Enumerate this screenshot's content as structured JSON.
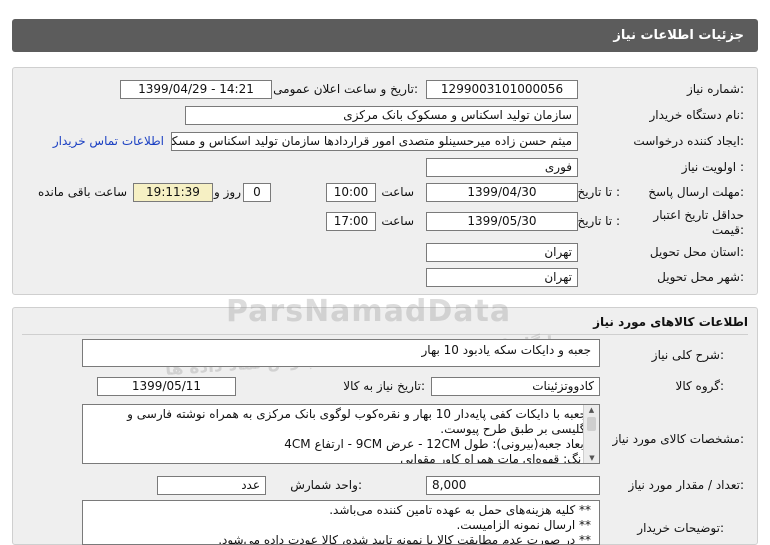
{
  "header": {
    "title": "جزئیات اطلاعات نیاز"
  },
  "request": {
    "number_label": "شماره نیاز:",
    "number": "1299003101000056",
    "announce_label": "تاریخ و ساعت اعلان عمومی:",
    "announce_value": "1399/04/29 - 14:21",
    "buyer_org_label": "نام دستگاه خریدار:",
    "buyer_org": "سازمان تولید اسکناس و مسکوک بانک مرکزی",
    "creator_label": "ایجاد کننده درخواست:",
    "creator": "میثم حسن زاده میرحسینلو متصدی امور قراردادها سازمان تولید اسکناس و مسکوک بانک مرکزی",
    "contact_link": "اطلاعات تماس خریدار",
    "priority_label": "اولویت نیاز :",
    "priority": "فوری",
    "deadline_label": "مهلت ارسال پاسخ:",
    "to_date_label": "تا تاریخ :",
    "deadline_date": "1399/04/30",
    "time_label": "ساعت",
    "deadline_time": "10:00",
    "days_value": "0",
    "days_label": "روز و",
    "remaining_time": "19:11:39",
    "remaining_label": "ساعت باقی مانده",
    "validity_label": "حداقل تاریخ اعتبار قیمت:",
    "validity_to_label": "تا تاریخ :",
    "validity_date": "1399/05/30",
    "validity_time_label": "ساعت",
    "validity_time": "17:00",
    "province_label": "استان محل تحویل:",
    "province": "تهران",
    "city_label": "شهر محل تحویل:",
    "city": "تهران"
  },
  "goods": {
    "section_title": "اطلاعات کالاهای مورد نیاز",
    "desc_label": "شرح کلی نیاز:",
    "desc": "جعبه و دایکات سکه یادبود 10 بهار",
    "group_label": "گروه کالا:",
    "group": "کادووتزئینات",
    "need_date_label": "تاریخ نیاز به کالا:",
    "need_date": "1399/05/11",
    "spec_label": "مشخصات کالای مورد نیاز:",
    "spec_lines": [
      "*جعبه با دایکات کفی پایه‌دار 10 بهار و نقره‌کوب لوگوی بانک مرکزی به همراه نوشته فارسی و",
      "انگلیسی بر طبق طرح پیوست.",
      "*ابعاد جعبه(بیرونی): طول 12CM - عرض 9CM - ارتفاع 4CM",
      "*رنگ: قهوه‌ای مات همراه کاور مقوایی"
    ],
    "unit_label": "واحد شمارش:",
    "unit": "عدد",
    "qty_label": "تعداد / مقدار مورد نیاز:",
    "qty": "8,000",
    "notes_label": "توضیحات خریدار:",
    "notes_lines": [
      "**  کلیه هزینه‌های حمل به عهده تامین کننده می‌باشد.",
      "**  ارسال نمونه الزامیست.",
      "**  در صورت عدم مطابقت کالا با نمونه تایید شده، کالا عودت داده می‌شود."
    ]
  },
  "watermark": {
    "brand": "ParsNamadData",
    "fa_line": "پایگاه اطلاع رسانی مناقصات پارس نماد داده ها"
  }
}
